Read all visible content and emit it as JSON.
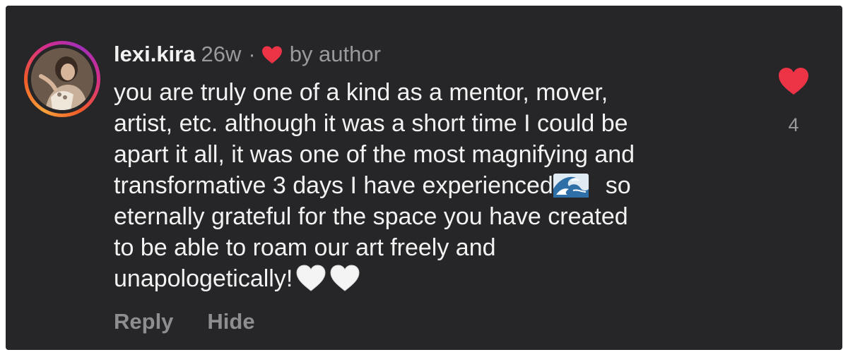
{
  "comment": {
    "username": "lexi.kira",
    "time": "26w",
    "separator": "·",
    "liked_by_label": "by author",
    "text_lines": [
      "you are truly one of a kind as a mentor, mover,",
      "artist, etc. although it was a short time I could be",
      "apart it all, it was one of the most magnifying and",
      "transformative 3 days I have experienced",
      "eternally grateful for the space you have created",
      "to be able to roam our art freely and",
      "unapologetically!"
    ],
    "line4_after_emoji": "so",
    "like_count": "4",
    "actions": {
      "reply_label": "Reply",
      "hide_label": "Hide"
    }
  },
  "icons": {
    "author_like": "red-heart-icon",
    "like": "red-heart-icon",
    "wave_emoji": "water-wave-emoji-icon",
    "white_heart_emoji": "white-heart-emoji-icon"
  },
  "colors": {
    "background": "#262628",
    "heart_red": "#ed3447",
    "text_primary": "#f2f2f2",
    "text_secondary": "#9a9a9e",
    "ring_gradient": [
      "#f9a13a",
      "#f05a28",
      "#d62e8a",
      "#a02fb8"
    ]
  }
}
